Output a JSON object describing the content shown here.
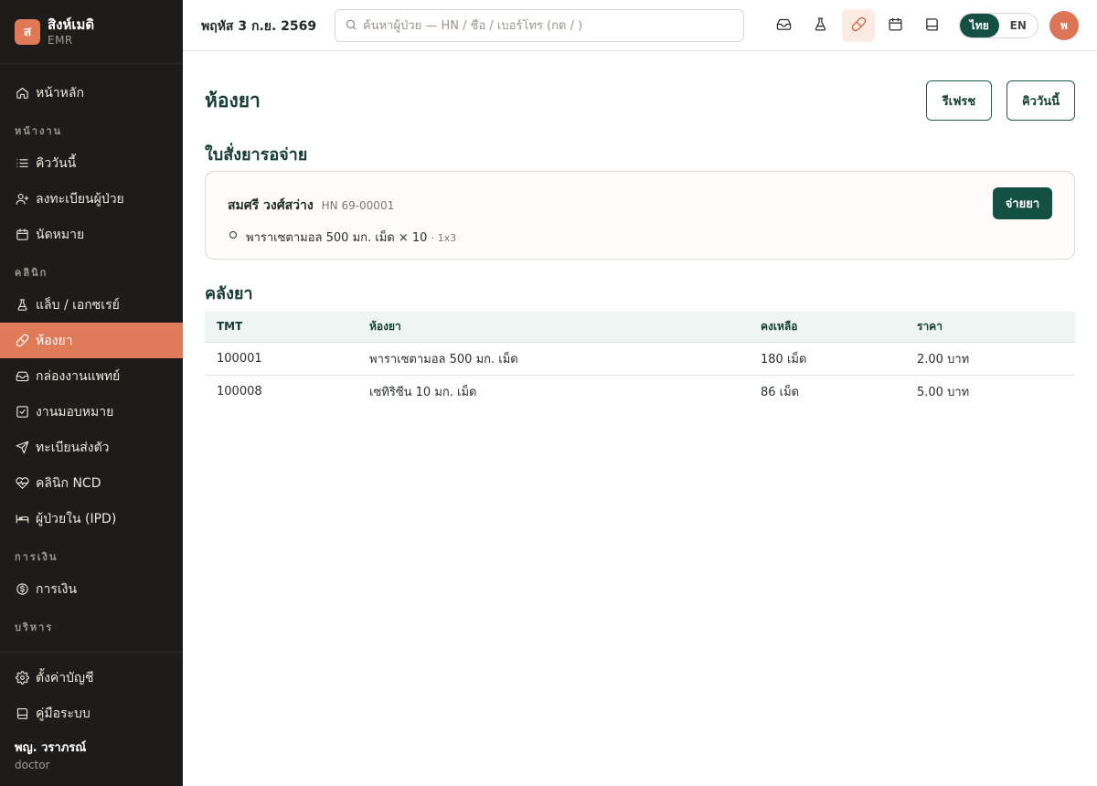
{
  "sidebar": {
    "brand": {
      "logo_letter": "ส",
      "name": "สิงห์เมดิ",
      "subtitle": "EMR"
    },
    "home": {
      "label": "หน้าหลัก",
      "icon": "home-icon"
    },
    "sections": [
      {
        "title": "หน้างาน",
        "items": [
          {
            "label": "คิววันนี้",
            "icon": "list-icon"
          },
          {
            "label": "ลงทะเบียนผู้ป่วย",
            "icon": "user-plus-icon"
          },
          {
            "label": "นัดหมาย",
            "icon": "calendar-icon"
          }
        ]
      },
      {
        "title": "คลินิก",
        "items": [
          {
            "label": "แล็บ / เอกซเรย์",
            "icon": "flask-icon"
          },
          {
            "label": "ห้องยา",
            "icon": "pill-icon",
            "active": true
          },
          {
            "label": "กล่องงานแพทย์",
            "icon": "inbox-icon"
          },
          {
            "label": "งานมอบหมาย",
            "icon": "checkbox-icon"
          },
          {
            "label": "ทะเบียนส่งตัว",
            "icon": "send-icon"
          },
          {
            "label": "คลินิก NCD",
            "icon": "heart-icon"
          },
          {
            "label": "ผู้ป่วยใน (IPD)",
            "icon": "bed-icon"
          }
        ]
      },
      {
        "title": "การเงิน",
        "items": [
          {
            "label": "การเงิน",
            "icon": "dollar-icon"
          }
        ]
      },
      {
        "title": "บริหาร",
        "items": []
      }
    ],
    "bottom": [
      {
        "label": "ตั้งค่าบัญชี",
        "icon": "gear-icon"
      },
      {
        "label": "คู่มือระบบ",
        "icon": "book-icon"
      }
    ],
    "user": {
      "name": "พญ. วราภรณ์",
      "role": "doctor"
    }
  },
  "topbar": {
    "date": "พฤหัส 3 ก.ย. 2569",
    "search_placeholder": "ค้นหาผู้ป่วย — HN / ชื่อ / เบอร์โทร (กด / )",
    "icons": [
      "inbox-icon",
      "flask-icon",
      "pill-icon",
      "calendar-icon",
      "book-icon"
    ],
    "active_icon": "pill-icon",
    "lang": {
      "th": "ไทย",
      "en": "EN",
      "selected": "th"
    },
    "avatar_letter": "พ"
  },
  "main": {
    "title": "ห้องยา",
    "refresh_label": "รีเฟรช",
    "queue_label": "คิววันนี้",
    "pending_title": "ใบสั่งยารอจ่าย",
    "prescription": {
      "patient_name": "สมศรี วงศ์สว่าง",
      "hn": "HN 69-00001",
      "dispense_label": "จ่ายยา",
      "item_text": "พาราเซตามอล 500 มก. เม็ด × 10",
      "item_sig": "· 1x3"
    },
    "stock_title": "คลังยา",
    "stock_table": {
      "headers": [
        "TMT",
        "ห้องยา",
        "คงเหลือ",
        "ราคา"
      ],
      "rows": [
        [
          "100001",
          "พาราเซตามอล 500 มก. เม็ด",
          "180 เม็ด",
          "2.00 บาท"
        ],
        [
          "100008",
          "เซทิริซีน 10 มก. เม็ด",
          "86 เม็ด",
          "5.00 บาท"
        ]
      ]
    }
  },
  "colors": {
    "accent": "#df7b59",
    "primary": "#134f43",
    "sidebar_bg": "#1e1c1b"
  }
}
